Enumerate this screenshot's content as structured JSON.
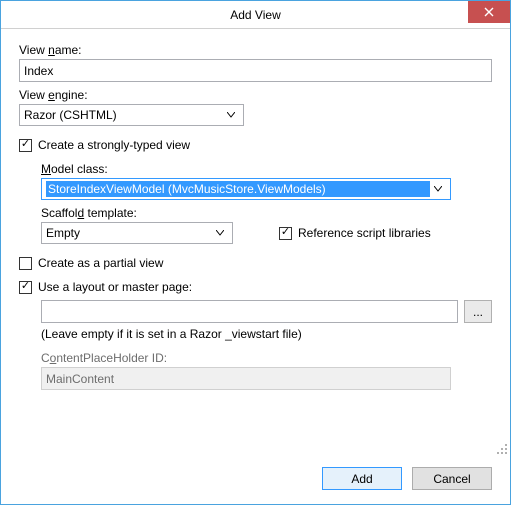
{
  "title": "Add View",
  "viewName": {
    "label": "View name:",
    "value": "Index"
  },
  "viewEngine": {
    "label": "View engine:",
    "value": "Razor (CSHTML)"
  },
  "stronglyTyped": {
    "checked": true,
    "label": "Create a strongly-typed view"
  },
  "modelClass": {
    "label": "Model class:",
    "value": "StoreIndexViewModel (MvcMusicStore.ViewModels)"
  },
  "scaffold": {
    "label": "Scaffold template:",
    "value": "Empty"
  },
  "refScripts": {
    "checked": true,
    "label": "Reference script libraries"
  },
  "partial": {
    "checked": false,
    "label": "Create as a partial view"
  },
  "useLayout": {
    "checked": true,
    "label": "Use a layout or master page:"
  },
  "layoutPath": {
    "value": ""
  },
  "layoutHelp": "(Leave empty if it is set in a Razor _viewstart file)",
  "contentPlaceholder": {
    "label": "ContentPlaceHolder ID:",
    "value": "MainContent"
  },
  "browseLabel": "...",
  "buttons": {
    "add": "Add",
    "cancel": "Cancel"
  }
}
